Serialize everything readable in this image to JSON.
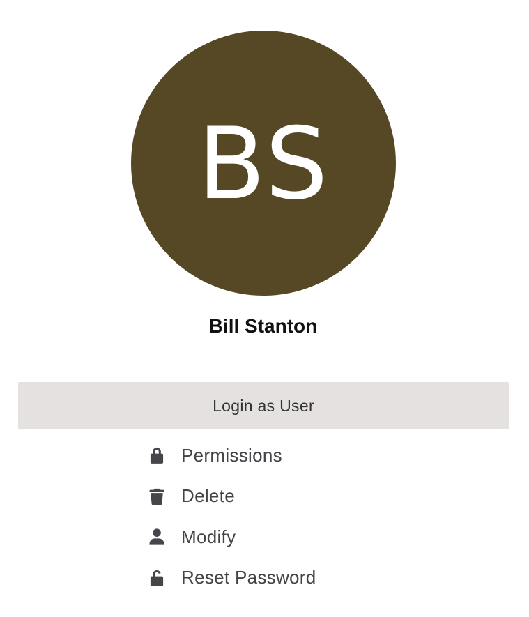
{
  "profile": {
    "initials": "BS",
    "name": "Bill Stanton",
    "avatar_color": "#564824"
  },
  "login_button": {
    "label": "Login as User"
  },
  "actions": [
    {
      "label": "Permissions",
      "icon": "lock-icon"
    },
    {
      "label": "Delete",
      "icon": "trash-icon"
    },
    {
      "label": "Modify",
      "icon": "user-icon"
    },
    {
      "label": "Reset Password",
      "icon": "unlock-icon"
    }
  ]
}
